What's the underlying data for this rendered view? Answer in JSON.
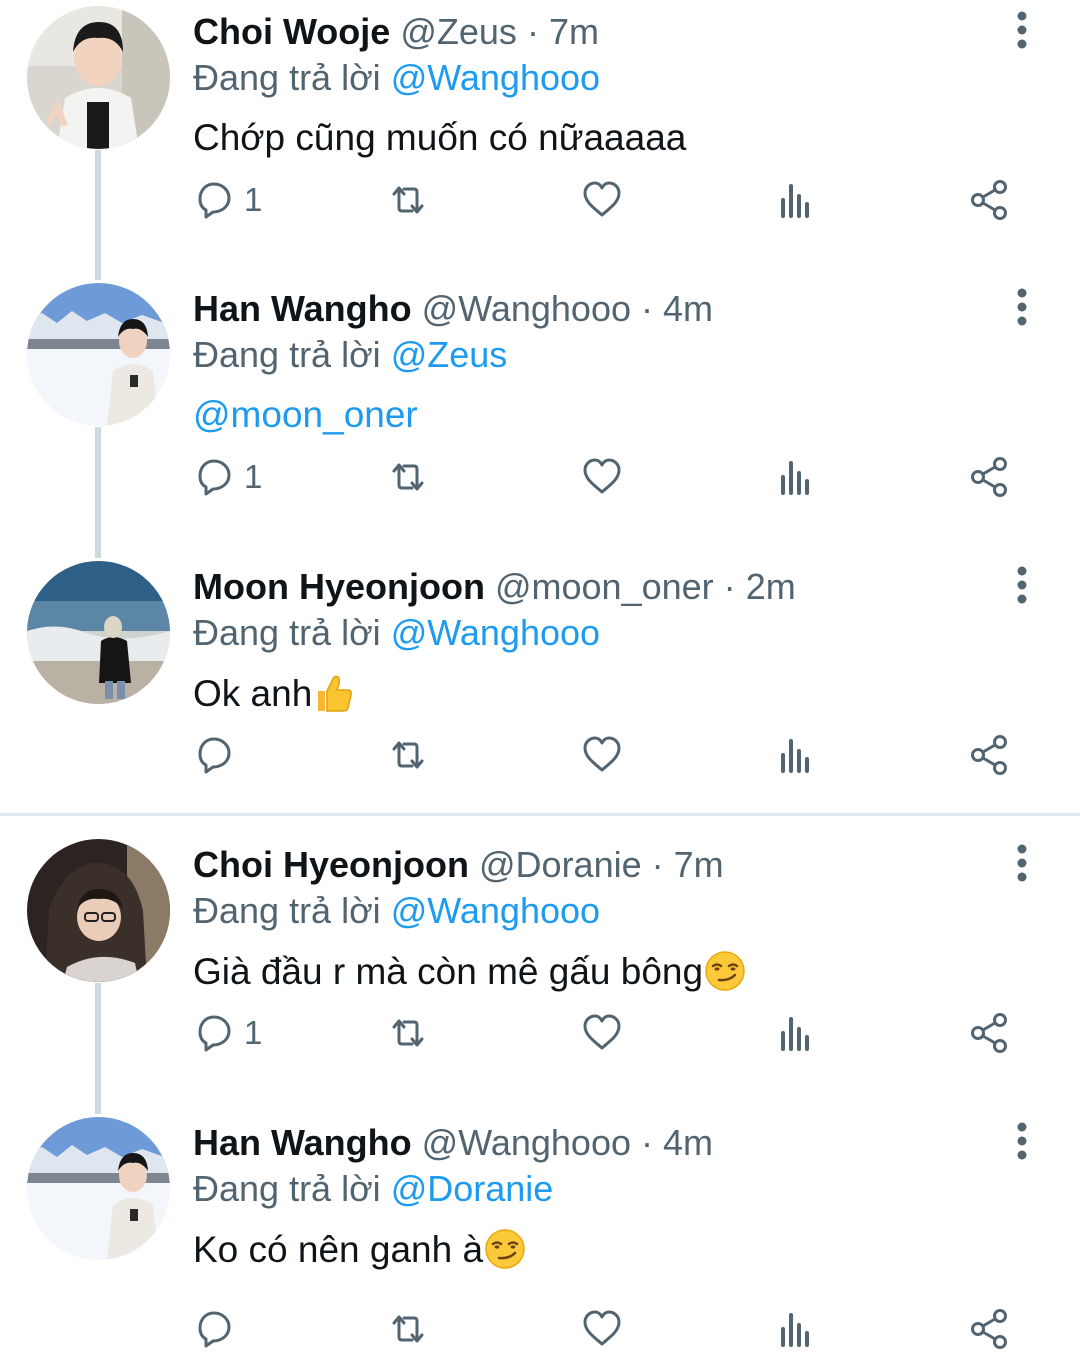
{
  "replying_label": "Đang trả lời",
  "tweets": [
    {
      "name": "Choi Wooje",
      "handle": "@Zeus",
      "time": "7m",
      "reply_to": "@Wanghooo",
      "text": "Chớp cũng muốn có nữaaaaa",
      "reply_count": "1"
    },
    {
      "name": "Han Wangho",
      "handle": "@Wanghooo",
      "time": "4m",
      "reply_to": "@Zeus",
      "text": "@moon_oner",
      "reply_count": "1"
    },
    {
      "name": "Moon Hyeonjoon",
      "handle": "@moon_oner",
      "time": "2m",
      "reply_to": "@Wanghooo",
      "text": "Ok anh",
      "text_emoji": "thumbs-up-emoji",
      "reply_count": ""
    },
    {
      "name": "Choi Hyeonjoon",
      "handle": "@Doranie",
      "time": "7m",
      "reply_to": "@Wanghooo",
      "text": "Già đầu r mà còn mê gấu bông",
      "text_emoji": "smirking-face-emoji",
      "reply_count": "1"
    },
    {
      "name": "Han Wangho",
      "handle": "@Wanghooo",
      "time": "4m",
      "reply_to": "@Doranie",
      "text": "Ko có nên ganh à",
      "text_emoji": "smirking-face-emoji",
      "reply_count": ""
    }
  ],
  "icons": {
    "reply": "reply-icon",
    "retweet": "retweet-icon",
    "like": "heart-icon",
    "views": "analytics-icon",
    "share": "share-icon",
    "more": "more-options-icon"
  },
  "colors": {
    "accent": "#1d9bf0",
    "secondary_text": "#536471",
    "primary_text": "#0f1419",
    "thread_line": "#cfd9de"
  }
}
